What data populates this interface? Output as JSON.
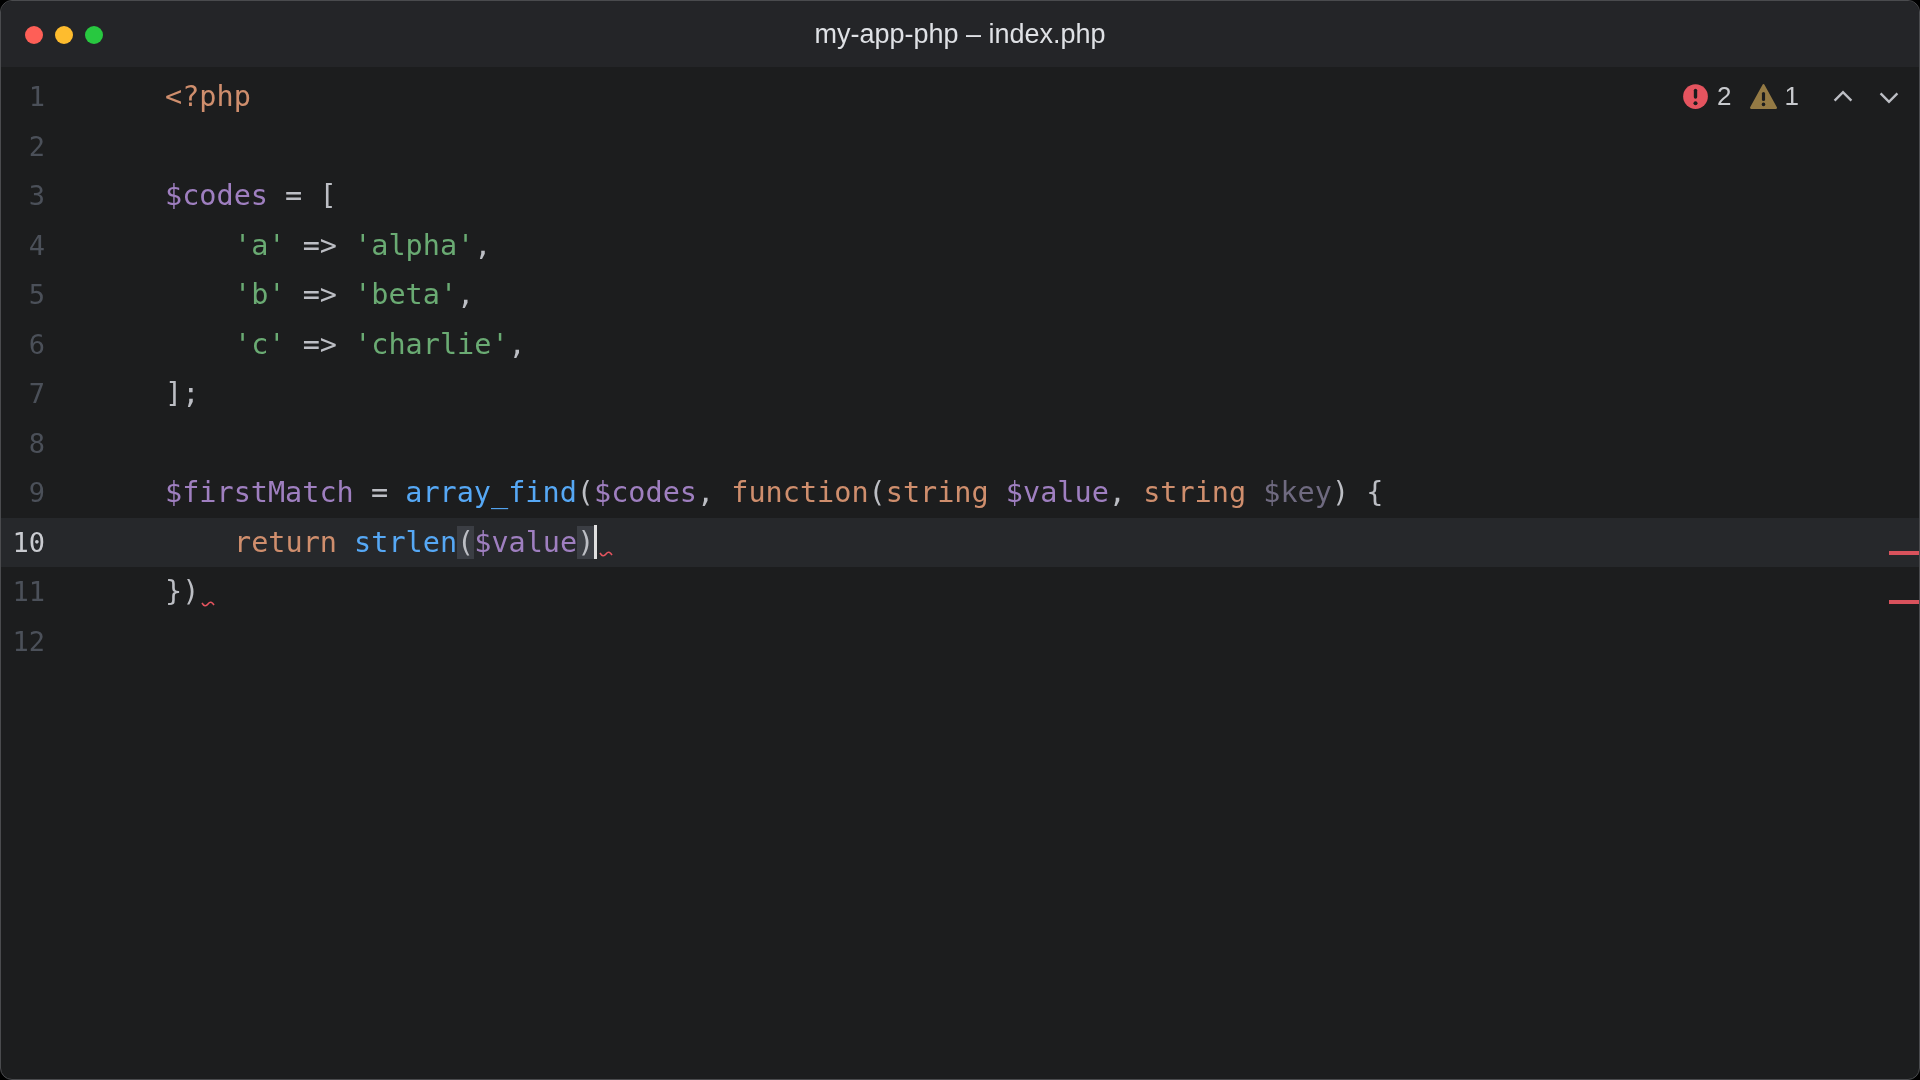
{
  "window": {
    "title": "my-app-php – index.php"
  },
  "problems": {
    "errors": "2",
    "warnings": "1"
  },
  "lines": [
    {
      "number": "1",
      "current": false,
      "cursor": false,
      "error": false,
      "indented": false,
      "tokens": [
        {
          "kind": "tag",
          "text": "<?php"
        }
      ]
    },
    {
      "number": "2",
      "current": false,
      "cursor": false,
      "error": false
    },
    {
      "number": "3",
      "current": false,
      "cursor": false,
      "error": false,
      "indented": false,
      "tokens": [
        {
          "kind": "var",
          "text": "$codes"
        },
        {
          "kind": "plain",
          "text": " = ["
        }
      ]
    },
    {
      "number": "4",
      "current": false,
      "cursor": false,
      "error": false,
      "indented": true,
      "tokens": [
        {
          "kind": "string",
          "text": "'a'"
        },
        {
          "kind": "plain",
          "text": " => "
        },
        {
          "kind": "string",
          "text": "'alpha'"
        },
        {
          "kind": "plain",
          "text": ","
        }
      ]
    },
    {
      "number": "5",
      "current": false,
      "cursor": false,
      "error": false,
      "indented": true,
      "tokens": [
        {
          "kind": "string",
          "text": "'b'"
        },
        {
          "kind": "plain",
          "text": " => "
        },
        {
          "kind": "string",
          "text": "'beta'"
        },
        {
          "kind": "plain",
          "text": ","
        }
      ]
    },
    {
      "number": "6",
      "current": false,
      "cursor": false,
      "error": false,
      "indented": true,
      "tokens": [
        {
          "kind": "string",
          "text": "'c'"
        },
        {
          "kind": "plain",
          "text": " => "
        },
        {
          "kind": "string",
          "text": "'charlie'"
        },
        {
          "kind": "plain",
          "text": ","
        }
      ]
    },
    {
      "number": "7",
      "current": false,
      "cursor": false,
      "error": false,
      "indented": false,
      "tokens": [
        {
          "kind": "plain",
          "text": "];"
        }
      ]
    },
    {
      "number": "8",
      "current": false,
      "cursor": false,
      "error": false
    },
    {
      "number": "9",
      "current": false,
      "cursor": false,
      "error": false,
      "indented": false,
      "tokens": [
        {
          "kind": "var",
          "text": "$firstMatch"
        },
        {
          "kind": "plain",
          "text": " = "
        },
        {
          "kind": "func",
          "text": "array_find"
        },
        {
          "kind": "plain",
          "text": "("
        },
        {
          "kind": "var",
          "text": "$codes"
        },
        {
          "kind": "plain",
          "text": ", "
        },
        {
          "kind": "keyword",
          "text": "function"
        },
        {
          "kind": "plain",
          "text": "("
        },
        {
          "kind": "keyword",
          "text": "string "
        },
        {
          "kind": "var",
          "text": "$value"
        },
        {
          "kind": "plain",
          "text": ", "
        },
        {
          "kind": "keyword",
          "text": "string "
        },
        {
          "kind": "unused",
          "text": "$key"
        },
        {
          "kind": "plain",
          "text": ") {"
        }
      ]
    },
    {
      "number": "10",
      "current": true,
      "cursor": true,
      "error": true,
      "indented": true,
      "tokens": [
        {
          "kind": "keyword",
          "text": "return "
        },
        {
          "kind": "func",
          "text": "strlen"
        },
        {
          "kind": "paren",
          "text": "(",
          "matched": true
        },
        {
          "kind": "var",
          "text": "$value"
        },
        {
          "kind": "paren",
          "text": ")",
          "matched": true
        }
      ]
    },
    {
      "number": "11",
      "current": false,
      "cursor": false,
      "error": true,
      "indented": false,
      "tokens": [
        {
          "kind": "plain",
          "text": "})"
        }
      ]
    },
    {
      "number": "12",
      "current": false,
      "cursor": false,
      "error": false
    }
  ]
}
